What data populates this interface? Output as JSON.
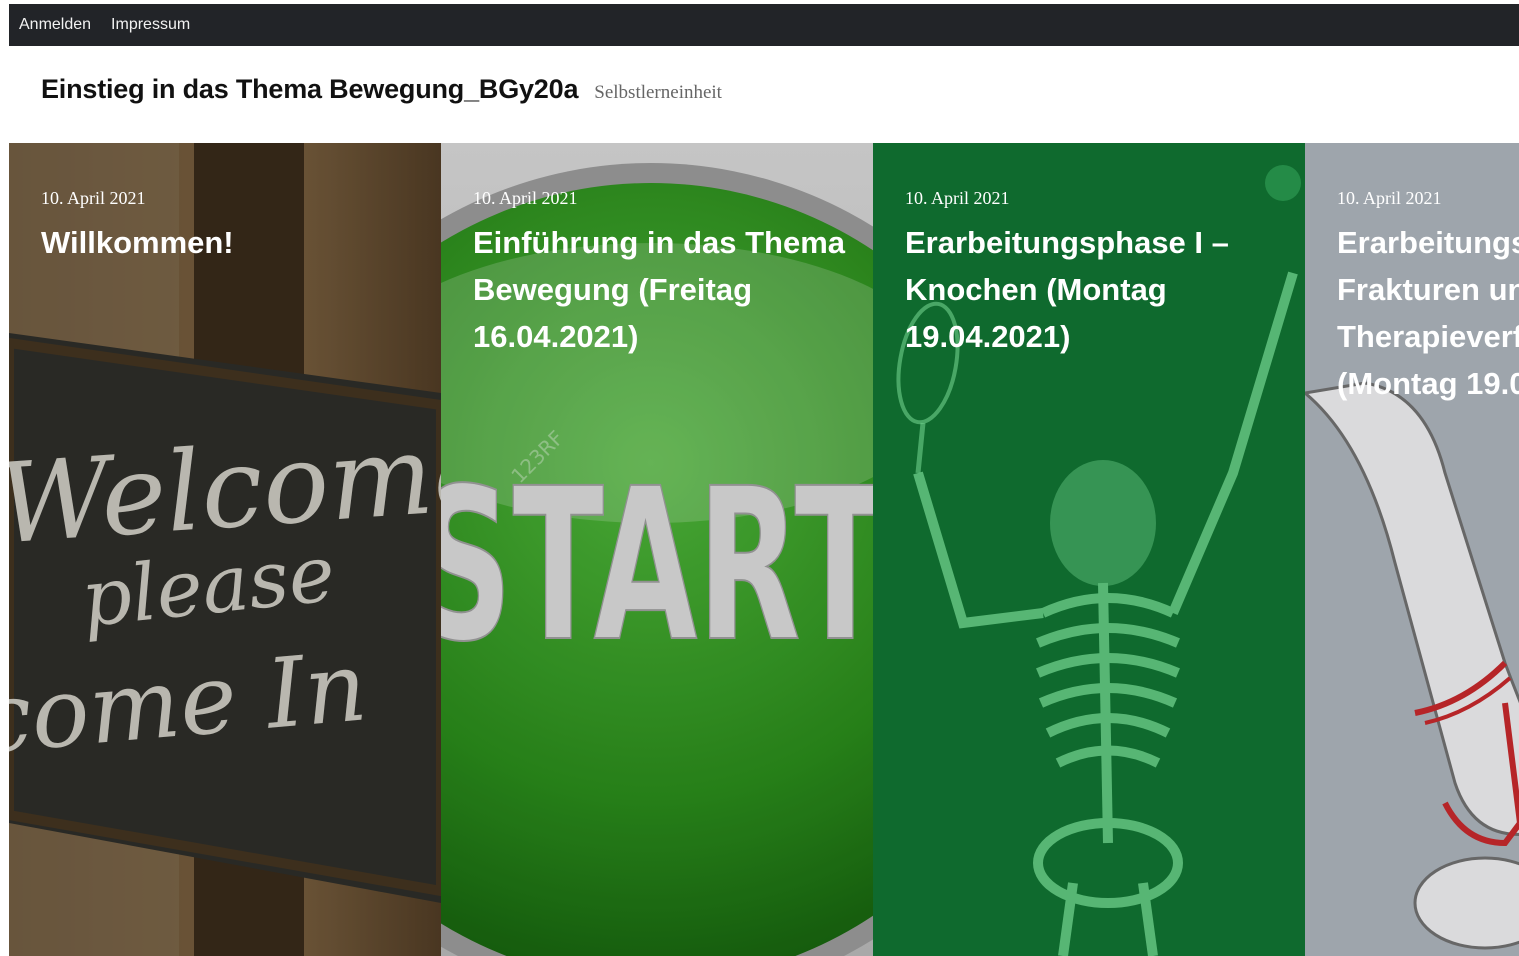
{
  "nav": {
    "items": [
      {
        "label": "Anmelden"
      },
      {
        "label": "Impressum"
      }
    ]
  },
  "header": {
    "title": "Einstieg in das Thema Bewegung_BGy20a",
    "description": "Selbstlerneinheit"
  },
  "posts": [
    {
      "date": "10. April 2021",
      "title": "Willkommen!",
      "image": {
        "lines": [
          "Welcome",
          "please",
          "come In"
        ],
        "bg": "#3b3a35"
      }
    },
    {
      "date": "10. April 2021",
      "title": "Einführung in das Thema\nBewegung (Freitag\n16.04.2021)",
      "image": {
        "text": "START",
        "watermark": "123RF",
        "bg": "#c9c9c9",
        "accent": "#2f8a1c"
      }
    },
    {
      "date": "10. April 2021",
      "title": "Erarbeitungsphase I –\nKnochen (Montag\n19.04.2021)",
      "image": {
        "bg": "#0f6a2e",
        "accent": "#6fd08c"
      }
    },
    {
      "date": "10. April 2021",
      "title": "Erarbeitungs\nFrakturen un\nTherapieverf\n(Montag 19.0",
      "image": {
        "bg": "#a7aeb6",
        "accent": "#c0282b"
      }
    }
  ]
}
